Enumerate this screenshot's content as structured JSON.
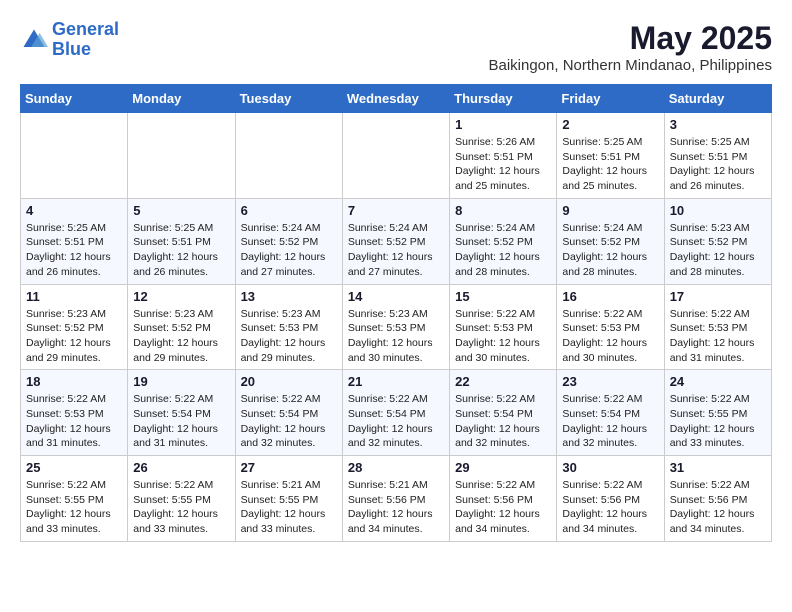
{
  "header": {
    "logo_line1": "General",
    "logo_line2": "Blue",
    "month_year": "May 2025",
    "location": "Baikingon, Northern Mindanao, Philippines"
  },
  "days_of_week": [
    "Sunday",
    "Monday",
    "Tuesday",
    "Wednesday",
    "Thursday",
    "Friday",
    "Saturday"
  ],
  "weeks": [
    [
      {
        "day": "",
        "info": ""
      },
      {
        "day": "",
        "info": ""
      },
      {
        "day": "",
        "info": ""
      },
      {
        "day": "",
        "info": ""
      },
      {
        "day": "1",
        "info": "Sunrise: 5:26 AM\nSunset: 5:51 PM\nDaylight: 12 hours\nand 25 minutes."
      },
      {
        "day": "2",
        "info": "Sunrise: 5:25 AM\nSunset: 5:51 PM\nDaylight: 12 hours\nand 25 minutes."
      },
      {
        "day": "3",
        "info": "Sunrise: 5:25 AM\nSunset: 5:51 PM\nDaylight: 12 hours\nand 26 minutes."
      }
    ],
    [
      {
        "day": "4",
        "info": "Sunrise: 5:25 AM\nSunset: 5:51 PM\nDaylight: 12 hours\nand 26 minutes."
      },
      {
        "day": "5",
        "info": "Sunrise: 5:25 AM\nSunset: 5:51 PM\nDaylight: 12 hours\nand 26 minutes."
      },
      {
        "day": "6",
        "info": "Sunrise: 5:24 AM\nSunset: 5:52 PM\nDaylight: 12 hours\nand 27 minutes."
      },
      {
        "day": "7",
        "info": "Sunrise: 5:24 AM\nSunset: 5:52 PM\nDaylight: 12 hours\nand 27 minutes."
      },
      {
        "day": "8",
        "info": "Sunrise: 5:24 AM\nSunset: 5:52 PM\nDaylight: 12 hours\nand 28 minutes."
      },
      {
        "day": "9",
        "info": "Sunrise: 5:24 AM\nSunset: 5:52 PM\nDaylight: 12 hours\nand 28 minutes."
      },
      {
        "day": "10",
        "info": "Sunrise: 5:23 AM\nSunset: 5:52 PM\nDaylight: 12 hours\nand 28 minutes."
      }
    ],
    [
      {
        "day": "11",
        "info": "Sunrise: 5:23 AM\nSunset: 5:52 PM\nDaylight: 12 hours\nand 29 minutes."
      },
      {
        "day": "12",
        "info": "Sunrise: 5:23 AM\nSunset: 5:52 PM\nDaylight: 12 hours\nand 29 minutes."
      },
      {
        "day": "13",
        "info": "Sunrise: 5:23 AM\nSunset: 5:53 PM\nDaylight: 12 hours\nand 29 minutes."
      },
      {
        "day": "14",
        "info": "Sunrise: 5:23 AM\nSunset: 5:53 PM\nDaylight: 12 hours\nand 30 minutes."
      },
      {
        "day": "15",
        "info": "Sunrise: 5:22 AM\nSunset: 5:53 PM\nDaylight: 12 hours\nand 30 minutes."
      },
      {
        "day": "16",
        "info": "Sunrise: 5:22 AM\nSunset: 5:53 PM\nDaylight: 12 hours\nand 30 minutes."
      },
      {
        "day": "17",
        "info": "Sunrise: 5:22 AM\nSunset: 5:53 PM\nDaylight: 12 hours\nand 31 minutes."
      }
    ],
    [
      {
        "day": "18",
        "info": "Sunrise: 5:22 AM\nSunset: 5:53 PM\nDaylight: 12 hours\nand 31 minutes."
      },
      {
        "day": "19",
        "info": "Sunrise: 5:22 AM\nSunset: 5:54 PM\nDaylight: 12 hours\nand 31 minutes."
      },
      {
        "day": "20",
        "info": "Sunrise: 5:22 AM\nSunset: 5:54 PM\nDaylight: 12 hours\nand 32 minutes."
      },
      {
        "day": "21",
        "info": "Sunrise: 5:22 AM\nSunset: 5:54 PM\nDaylight: 12 hours\nand 32 minutes."
      },
      {
        "day": "22",
        "info": "Sunrise: 5:22 AM\nSunset: 5:54 PM\nDaylight: 12 hours\nand 32 minutes."
      },
      {
        "day": "23",
        "info": "Sunrise: 5:22 AM\nSunset: 5:54 PM\nDaylight: 12 hours\nand 32 minutes."
      },
      {
        "day": "24",
        "info": "Sunrise: 5:22 AM\nSunset: 5:55 PM\nDaylight: 12 hours\nand 33 minutes."
      }
    ],
    [
      {
        "day": "25",
        "info": "Sunrise: 5:22 AM\nSunset: 5:55 PM\nDaylight: 12 hours\nand 33 minutes."
      },
      {
        "day": "26",
        "info": "Sunrise: 5:22 AM\nSunset: 5:55 PM\nDaylight: 12 hours\nand 33 minutes."
      },
      {
        "day": "27",
        "info": "Sunrise: 5:21 AM\nSunset: 5:55 PM\nDaylight: 12 hours\nand 33 minutes."
      },
      {
        "day": "28",
        "info": "Sunrise: 5:21 AM\nSunset: 5:56 PM\nDaylight: 12 hours\nand 34 minutes."
      },
      {
        "day": "29",
        "info": "Sunrise: 5:22 AM\nSunset: 5:56 PM\nDaylight: 12 hours\nand 34 minutes."
      },
      {
        "day": "30",
        "info": "Sunrise: 5:22 AM\nSunset: 5:56 PM\nDaylight: 12 hours\nand 34 minutes."
      },
      {
        "day": "31",
        "info": "Sunrise: 5:22 AM\nSunset: 5:56 PM\nDaylight: 12 hours\nand 34 minutes."
      }
    ]
  ]
}
